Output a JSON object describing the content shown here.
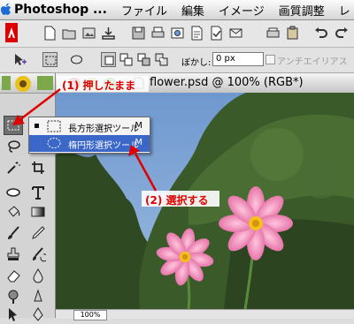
{
  "menubar": {
    "app": "Photoshop ...",
    "items": [
      "ファイル",
      "編集",
      "イメージ",
      "画質調整",
      "レ"
    ]
  },
  "options_bar": {
    "feather_label": "ぼかし:",
    "feather_value": "0 px",
    "antialias_label": "アンチエイリアス"
  },
  "document": {
    "title": "flower.psd @ 100% (RGB*)",
    "zoom": "100%"
  },
  "flyout": {
    "items": [
      {
        "label": "長方形選択ツール",
        "shortcut": "M",
        "selected": false,
        "current": true
      },
      {
        "label": "楕円形選択ツール",
        "shortcut": "M",
        "selected": true,
        "current": false
      }
    ]
  },
  "annotations": {
    "step1": "(1) 押したまま",
    "step2": "(2) 選択する",
    "color": "#e00000"
  },
  "colors": {
    "menu_highlight": "#3a67c8",
    "sky": "#7fa6d6",
    "flower_pink": "#f08ab7"
  }
}
